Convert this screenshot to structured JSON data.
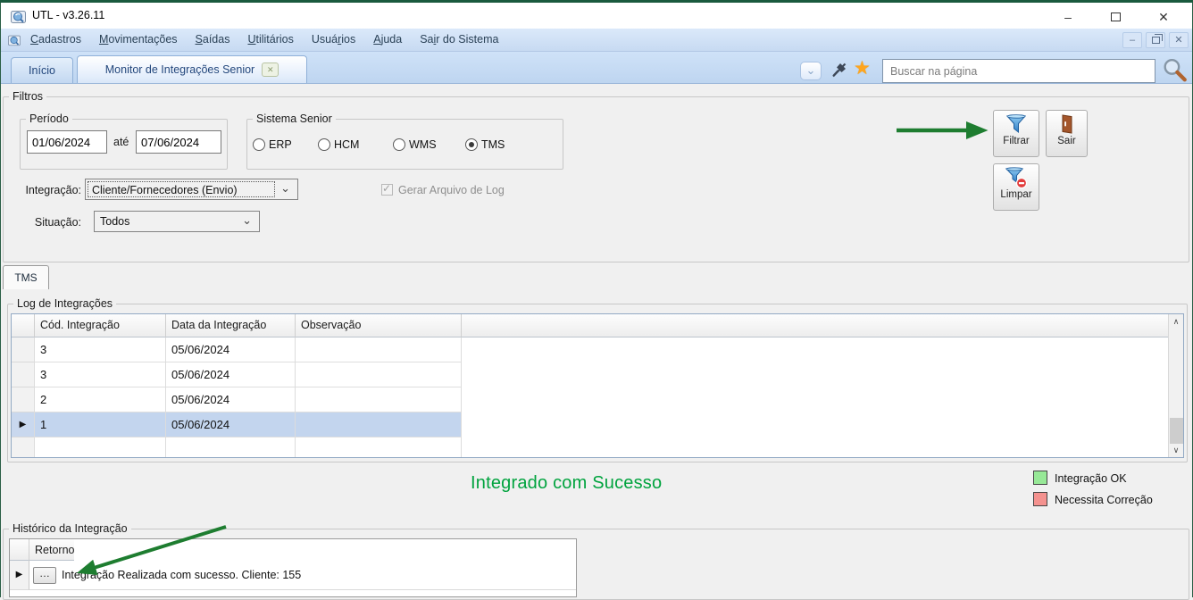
{
  "window": {
    "title": "UTL - v3.26.11"
  },
  "menu": {
    "items": [
      {
        "pre": "",
        "accel": "C",
        "post": "adastros"
      },
      {
        "pre": "",
        "accel": "M",
        "post": "ovimentações"
      },
      {
        "pre": "",
        "accel": "S",
        "post": "aídas"
      },
      {
        "pre": "",
        "accel": "U",
        "post": "tilitários"
      },
      {
        "pre": "Usuá",
        "accel": "r",
        "post": "ios"
      },
      {
        "pre": "",
        "accel": "A",
        "post": "juda"
      },
      {
        "pre": "Sa",
        "accel": "i",
        "post": "r do Sistema"
      }
    ]
  },
  "tabs": {
    "inicio": "Início",
    "active": "Monitor de Integrações Senior"
  },
  "search": {
    "placeholder": "Buscar na página"
  },
  "filters": {
    "group_label": "Filtros",
    "periodo": {
      "label": "Período",
      "from": "01/06/2024",
      "separator": "até",
      "to": "07/06/2024"
    },
    "sistema": {
      "label": "Sistema Senior",
      "options": [
        {
          "label": "ERP",
          "selected": false
        },
        {
          "label": "HCM",
          "selected": false
        },
        {
          "label": "WMS",
          "selected": false
        },
        {
          "label": "TMS",
          "selected": true
        }
      ]
    },
    "integracao": {
      "label": "Integração:",
      "value": "Cliente/Fornecedores (Envio)"
    },
    "log_checkbox": {
      "label": "Gerar Arquivo de Log",
      "checked": true,
      "disabled": true
    },
    "situacao": {
      "label": "Situação:",
      "value": "Todos"
    },
    "actions": {
      "filtrar": "Filtrar",
      "sair": "Sair",
      "limpar": "Limpar"
    }
  },
  "tms_page": {
    "tab_label": "TMS",
    "log_group_label": "Log de Integrações",
    "grid": {
      "columns": [
        "Cód. Integração",
        "Data da Integração",
        "Observação"
      ],
      "rows": [
        {
          "cod": "3",
          "data": "05/06/2024",
          "obs": ""
        },
        {
          "cod": "3",
          "data": "05/06/2024",
          "obs": ""
        },
        {
          "cod": "2",
          "data": "05/06/2024",
          "obs": ""
        },
        {
          "cod": "1",
          "data": "05/06/2024",
          "obs": ""
        }
      ],
      "selected_row_index": 3
    },
    "status_text": "Integrado com Sucesso",
    "status_color": "#00a33e",
    "legend": [
      {
        "label": "Integração OK",
        "color": "#97e897"
      },
      {
        "label": "Necessita Correção",
        "color": "#f4928f"
      }
    ]
  },
  "historico": {
    "group_label": "Histórico da Integração",
    "column": "Retorno",
    "row": {
      "ellipsis": "…",
      "text": "Integração Realizada com sucesso. Cliente: 155"
    }
  },
  "icons": {
    "window_minimize": "–",
    "window_close": "✕",
    "mdi_minimize": "–",
    "mdi_close": "✕",
    "tab_close": "✕",
    "chevron_down": "⌄",
    "star": "★",
    "combo_chevron": "⌄",
    "check": "✓",
    "scroll_up": "∧",
    "scroll_down": "∨",
    "row_indicator": "▶"
  },
  "colors": {
    "annotation_arrow_green": "#1e7d30"
  }
}
